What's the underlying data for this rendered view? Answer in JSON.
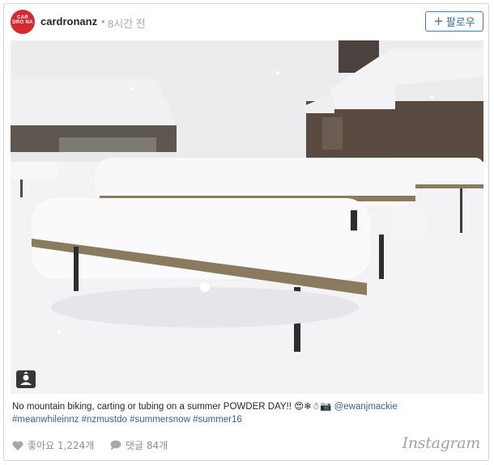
{
  "post": {
    "username": "cardronanz",
    "avatar_text": "CAR DRO NA",
    "separator": "•",
    "timestamp": "8시간 전",
    "follow_label": "팔로우",
    "follow_icon": "+"
  },
  "photo": {
    "description_icon": "user-profile-icon",
    "colors": {
      "snow": "#f4f4f6",
      "wood": "#8a7a5e",
      "sky": "#e9e9ec"
    }
  },
  "caption": {
    "text": "No mountain biking, carting or tubing on a summer POWDER DAY!! ",
    "emoji": "😍❄☃📷",
    "mention": "@ewanjmackie",
    "hashtags": "#meanwhileinnz #nzmustdo #summersnow #summer16"
  },
  "footer": {
    "likes_label": "좋아요 1,224개",
    "comments_label": "댓글 84개",
    "brand": "Instagram"
  },
  "colors": {
    "accent": "#3c6a9b",
    "avatar": "#d7282f"
  }
}
